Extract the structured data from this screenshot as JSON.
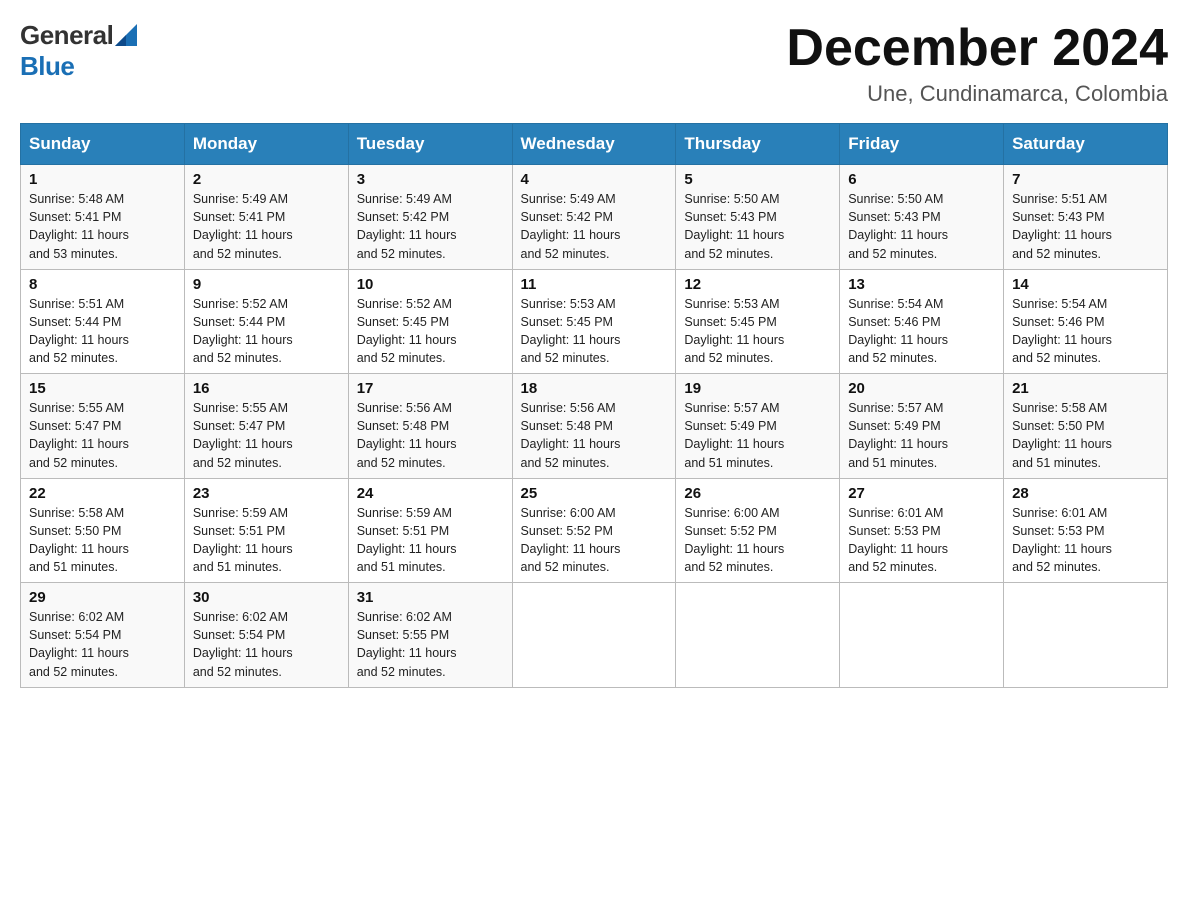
{
  "header": {
    "logo_general": "General",
    "logo_blue": "Blue",
    "title": "December 2024",
    "location": "Une, Cundinamarca, Colombia"
  },
  "days_of_week": [
    "Sunday",
    "Monday",
    "Tuesday",
    "Wednesday",
    "Thursday",
    "Friday",
    "Saturday"
  ],
  "weeks": [
    [
      {
        "day": "1",
        "sunrise": "5:48 AM",
        "sunset": "5:41 PM",
        "daylight": "11 hours and 53 minutes."
      },
      {
        "day": "2",
        "sunrise": "5:49 AM",
        "sunset": "5:41 PM",
        "daylight": "11 hours and 52 minutes."
      },
      {
        "day": "3",
        "sunrise": "5:49 AM",
        "sunset": "5:42 PM",
        "daylight": "11 hours and 52 minutes."
      },
      {
        "day": "4",
        "sunrise": "5:49 AM",
        "sunset": "5:42 PM",
        "daylight": "11 hours and 52 minutes."
      },
      {
        "day": "5",
        "sunrise": "5:50 AM",
        "sunset": "5:43 PM",
        "daylight": "11 hours and 52 minutes."
      },
      {
        "day": "6",
        "sunrise": "5:50 AM",
        "sunset": "5:43 PM",
        "daylight": "11 hours and 52 minutes."
      },
      {
        "day": "7",
        "sunrise": "5:51 AM",
        "sunset": "5:43 PM",
        "daylight": "11 hours and 52 minutes."
      }
    ],
    [
      {
        "day": "8",
        "sunrise": "5:51 AM",
        "sunset": "5:44 PM",
        "daylight": "11 hours and 52 minutes."
      },
      {
        "day": "9",
        "sunrise": "5:52 AM",
        "sunset": "5:44 PM",
        "daylight": "11 hours and 52 minutes."
      },
      {
        "day": "10",
        "sunrise": "5:52 AM",
        "sunset": "5:45 PM",
        "daylight": "11 hours and 52 minutes."
      },
      {
        "day": "11",
        "sunrise": "5:53 AM",
        "sunset": "5:45 PM",
        "daylight": "11 hours and 52 minutes."
      },
      {
        "day": "12",
        "sunrise": "5:53 AM",
        "sunset": "5:45 PM",
        "daylight": "11 hours and 52 minutes."
      },
      {
        "day": "13",
        "sunrise": "5:54 AM",
        "sunset": "5:46 PM",
        "daylight": "11 hours and 52 minutes."
      },
      {
        "day": "14",
        "sunrise": "5:54 AM",
        "sunset": "5:46 PM",
        "daylight": "11 hours and 52 minutes."
      }
    ],
    [
      {
        "day": "15",
        "sunrise": "5:55 AM",
        "sunset": "5:47 PM",
        "daylight": "11 hours and 52 minutes."
      },
      {
        "day": "16",
        "sunrise": "5:55 AM",
        "sunset": "5:47 PM",
        "daylight": "11 hours and 52 minutes."
      },
      {
        "day": "17",
        "sunrise": "5:56 AM",
        "sunset": "5:48 PM",
        "daylight": "11 hours and 52 minutes."
      },
      {
        "day": "18",
        "sunrise": "5:56 AM",
        "sunset": "5:48 PM",
        "daylight": "11 hours and 52 minutes."
      },
      {
        "day": "19",
        "sunrise": "5:57 AM",
        "sunset": "5:49 PM",
        "daylight": "11 hours and 51 minutes."
      },
      {
        "day": "20",
        "sunrise": "5:57 AM",
        "sunset": "5:49 PM",
        "daylight": "11 hours and 51 minutes."
      },
      {
        "day": "21",
        "sunrise": "5:58 AM",
        "sunset": "5:50 PM",
        "daylight": "11 hours and 51 minutes."
      }
    ],
    [
      {
        "day": "22",
        "sunrise": "5:58 AM",
        "sunset": "5:50 PM",
        "daylight": "11 hours and 51 minutes."
      },
      {
        "day": "23",
        "sunrise": "5:59 AM",
        "sunset": "5:51 PM",
        "daylight": "11 hours and 51 minutes."
      },
      {
        "day": "24",
        "sunrise": "5:59 AM",
        "sunset": "5:51 PM",
        "daylight": "11 hours and 51 minutes."
      },
      {
        "day": "25",
        "sunrise": "6:00 AM",
        "sunset": "5:52 PM",
        "daylight": "11 hours and 52 minutes."
      },
      {
        "day": "26",
        "sunrise": "6:00 AM",
        "sunset": "5:52 PM",
        "daylight": "11 hours and 52 minutes."
      },
      {
        "day": "27",
        "sunrise": "6:01 AM",
        "sunset": "5:53 PM",
        "daylight": "11 hours and 52 minutes."
      },
      {
        "day": "28",
        "sunrise": "6:01 AM",
        "sunset": "5:53 PM",
        "daylight": "11 hours and 52 minutes."
      }
    ],
    [
      {
        "day": "29",
        "sunrise": "6:02 AM",
        "sunset": "5:54 PM",
        "daylight": "11 hours and 52 minutes."
      },
      {
        "day": "30",
        "sunrise": "6:02 AM",
        "sunset": "5:54 PM",
        "daylight": "11 hours and 52 minutes."
      },
      {
        "day": "31",
        "sunrise": "6:02 AM",
        "sunset": "5:55 PM",
        "daylight": "11 hours and 52 minutes."
      },
      null,
      null,
      null,
      null
    ]
  ],
  "labels": {
    "sunrise": "Sunrise:",
    "sunset": "Sunset:",
    "daylight": "Daylight:"
  }
}
